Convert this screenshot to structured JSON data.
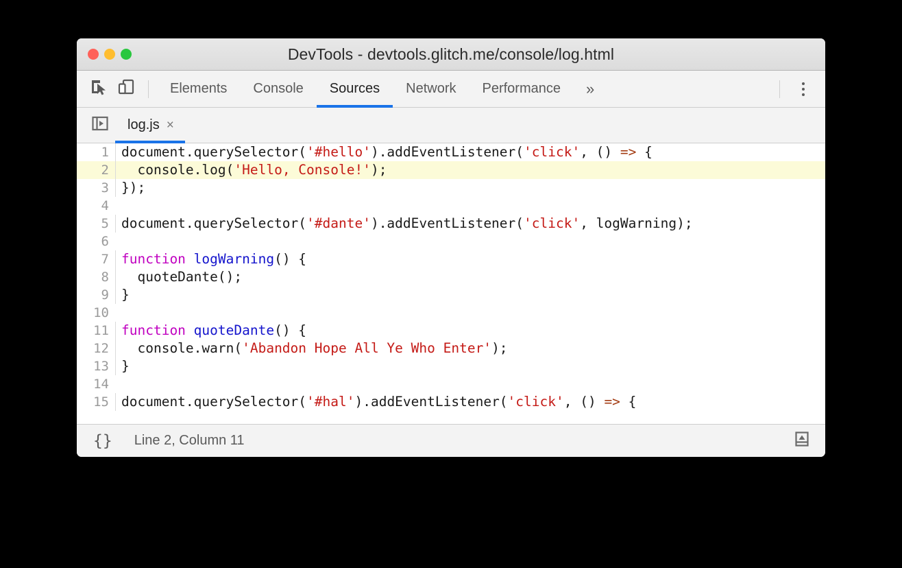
{
  "window": {
    "title": "DevTools - devtools.glitch.me/console/log.html",
    "traffic_lights": [
      {
        "name": "close",
        "color": "#ff6159"
      },
      {
        "name": "minimize",
        "color": "#ffbd2f"
      },
      {
        "name": "zoom",
        "color": "#2ac73f"
      }
    ]
  },
  "toolbar": {
    "inspect_icon": "inspect-element-icon",
    "device_icon": "device-toolbar-icon",
    "panels": [
      {
        "label": "Elements",
        "active": false
      },
      {
        "label": "Console",
        "active": false
      },
      {
        "label": "Sources",
        "active": true
      },
      {
        "label": "Network",
        "active": false
      },
      {
        "label": "Performance",
        "active": false
      }
    ],
    "overflow_label": "»",
    "more_icon": "more-vertical-icon",
    "accent_color": "#1a73e8"
  },
  "file_tabs": {
    "navigator_toggle_icon": "show-navigator-icon",
    "tabs": [
      {
        "label": "log.js",
        "close_label": "×",
        "active": true
      }
    ]
  },
  "editor": {
    "highlighted_line": 2,
    "lines": [
      {
        "n": "1",
        "tokens": [
          {
            "t": "document.querySelector(",
            "c": ""
          },
          {
            "t": "'#hello'",
            "c": "tok-str"
          },
          {
            "t": ").addEventListener(",
            "c": ""
          },
          {
            "t": "'click'",
            "c": "tok-str"
          },
          {
            "t": ", () ",
            "c": ""
          },
          {
            "t": "=>",
            "c": "tok-arrow"
          },
          {
            "t": " {",
            "c": ""
          }
        ]
      },
      {
        "n": "2",
        "tokens": [
          {
            "t": "  console.log(",
            "c": ""
          },
          {
            "t": "'Hello, Console!'",
            "c": "tok-str"
          },
          {
            "t": ");",
            "c": ""
          }
        ]
      },
      {
        "n": "3",
        "tokens": [
          {
            "t": "});",
            "c": ""
          }
        ]
      },
      {
        "n": "4",
        "tokens": [
          {
            "t": "",
            "c": ""
          }
        ]
      },
      {
        "n": "5",
        "tokens": [
          {
            "t": "document.querySelector(",
            "c": ""
          },
          {
            "t": "'#dante'",
            "c": "tok-str"
          },
          {
            "t": ").addEventListener(",
            "c": ""
          },
          {
            "t": "'click'",
            "c": "tok-str"
          },
          {
            "t": ", logWarning);",
            "c": ""
          }
        ]
      },
      {
        "n": "6",
        "tokens": [
          {
            "t": "",
            "c": ""
          }
        ]
      },
      {
        "n": "7",
        "tokens": [
          {
            "t": "function",
            "c": "tok-kw"
          },
          {
            "t": " ",
            "c": ""
          },
          {
            "t": "logWarning",
            "c": "tok-fn"
          },
          {
            "t": "() {",
            "c": ""
          }
        ]
      },
      {
        "n": "8",
        "tokens": [
          {
            "t": "  quoteDante();",
            "c": ""
          }
        ]
      },
      {
        "n": "9",
        "tokens": [
          {
            "t": "}",
            "c": ""
          }
        ]
      },
      {
        "n": "10",
        "tokens": [
          {
            "t": "",
            "c": ""
          }
        ]
      },
      {
        "n": "11",
        "tokens": [
          {
            "t": "function",
            "c": "tok-kw"
          },
          {
            "t": " ",
            "c": ""
          },
          {
            "t": "quoteDante",
            "c": "tok-fn"
          },
          {
            "t": "() {",
            "c": ""
          }
        ]
      },
      {
        "n": "12",
        "tokens": [
          {
            "t": "  console.warn(",
            "c": ""
          },
          {
            "t": "'Abandon Hope All Ye Who Enter'",
            "c": "tok-str"
          },
          {
            "t": ");",
            "c": ""
          }
        ]
      },
      {
        "n": "13",
        "tokens": [
          {
            "t": "}",
            "c": ""
          }
        ]
      },
      {
        "n": "14",
        "tokens": [
          {
            "t": "",
            "c": ""
          }
        ]
      },
      {
        "n": "15",
        "tokens": [
          {
            "t": "document.querySelector(",
            "c": ""
          },
          {
            "t": "'#hal'",
            "c": "tok-str"
          },
          {
            "t": ").addEventListener(",
            "c": ""
          },
          {
            "t": "'click'",
            "c": "tok-str"
          },
          {
            "t": ", () ",
            "c": ""
          },
          {
            "t": "=>",
            "c": "tok-arrow"
          },
          {
            "t": " {",
            "c": ""
          }
        ]
      }
    ],
    "colors": {
      "string": "#c41a16",
      "keyword": "#c000c0",
      "function_name": "#1414cc",
      "arrow": "#a33b12",
      "highlight_background": "#fcfbd8"
    }
  },
  "statusbar": {
    "pretty_print_label": "{}",
    "pretty_print_icon": "format-braces-icon",
    "cursor_position": "Line 2, Column 11",
    "drawer_icon": "show-console-drawer-icon"
  }
}
